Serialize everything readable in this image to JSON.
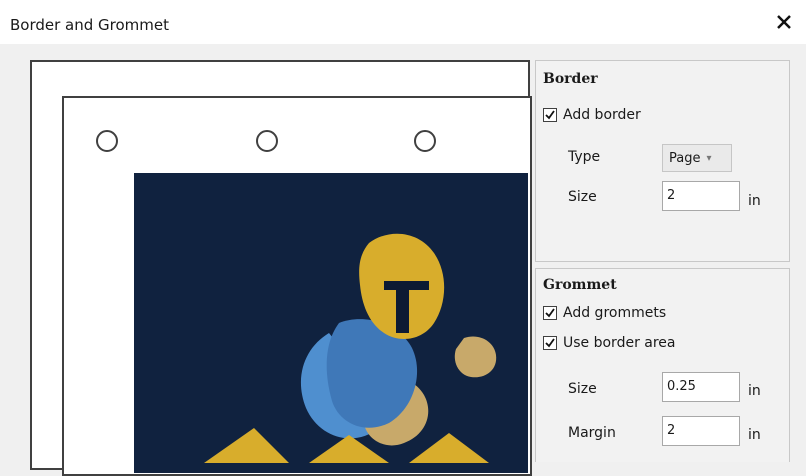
{
  "dialog": {
    "title": "Border and Grommet"
  },
  "border": {
    "section_title": "Border",
    "add_border": {
      "label": "Add border",
      "checked": true
    },
    "type": {
      "label": "Type",
      "value": "Page"
    },
    "size": {
      "label": "Size",
      "value": "2",
      "unit": "in"
    }
  },
  "grommet": {
    "section_title": "Grommet",
    "add_grommets": {
      "label": "Add grommets",
      "checked": true
    },
    "use_border_area": {
      "label": "Use border area",
      "checked": true
    },
    "size": {
      "label": "Size",
      "value": "0.25",
      "unit": "in"
    },
    "margin": {
      "label": "Margin",
      "value": "2",
      "unit": "in"
    }
  },
  "preview": {
    "background_color": "#10223f",
    "accent_gold": "#d8ad2c",
    "accent_blue": "#4f8fcf"
  }
}
